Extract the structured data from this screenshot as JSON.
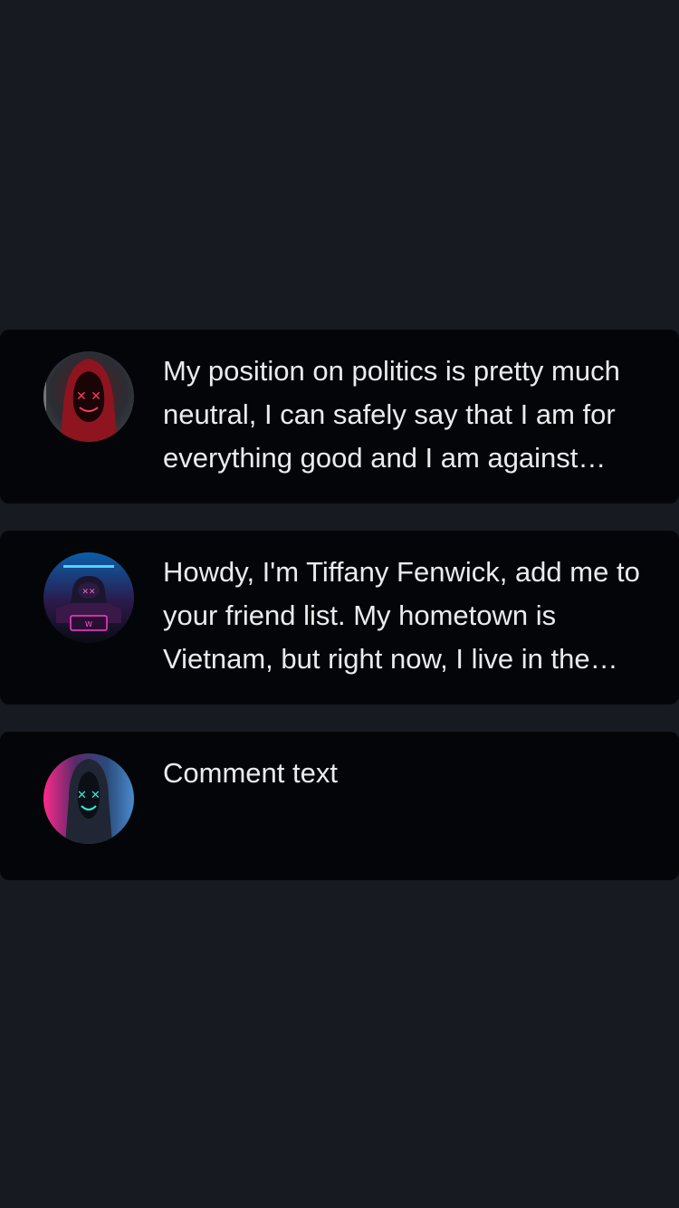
{
  "comments": [
    {
      "avatar_icon": "red-neon-masked-hooded-figure-avatar",
      "text": "My position on politics is pretty much neutral, I can safely say that I am for everything good and I am against everything bad."
    },
    {
      "avatar_icon": "blue-neon-hacker-laptop-avatar",
      "text": "Howdy, I'm Tiffany Fenwick, add me to your friend list. My hometown is Vietnam, but right now, I live in the city."
    },
    {
      "avatar_icon": "cyan-neon-masked-hooded-figure-avatar",
      "text": "Comment text"
    }
  ],
  "colors": {
    "background": "#171a21",
    "card": "#040508",
    "text": "#e9ebef"
  }
}
